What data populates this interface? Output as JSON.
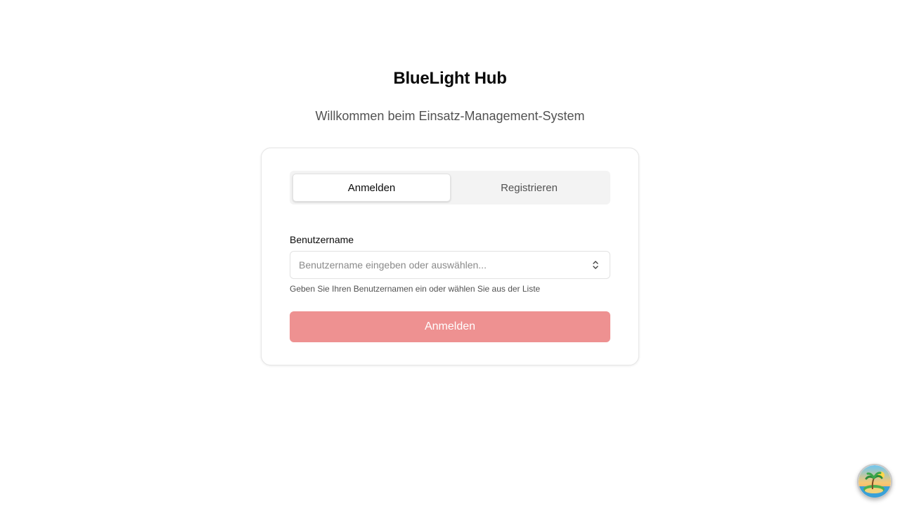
{
  "header": {
    "title": "BlueLight Hub",
    "subtitle": "Willkommen beim Einsatz-Management-System"
  },
  "tabs": [
    {
      "label": "Anmelden",
      "active": true
    },
    {
      "label": "Registrieren",
      "active": false
    }
  ],
  "form": {
    "username_label": "Benutzername",
    "username_value": "",
    "username_placeholder": "Benutzername eingeben oder auswählen...",
    "username_hint": "Geben Sie Ihren Benutzernamen ein oder wählen Sie aus der Liste",
    "submit_label": "Anmelden"
  },
  "icons": {
    "combo": "chevron-up-down-icon",
    "floating": "island-palm-icon"
  },
  "colors": {
    "submit_background": "#ee9191",
    "tab_track": "#f3f3f3"
  }
}
